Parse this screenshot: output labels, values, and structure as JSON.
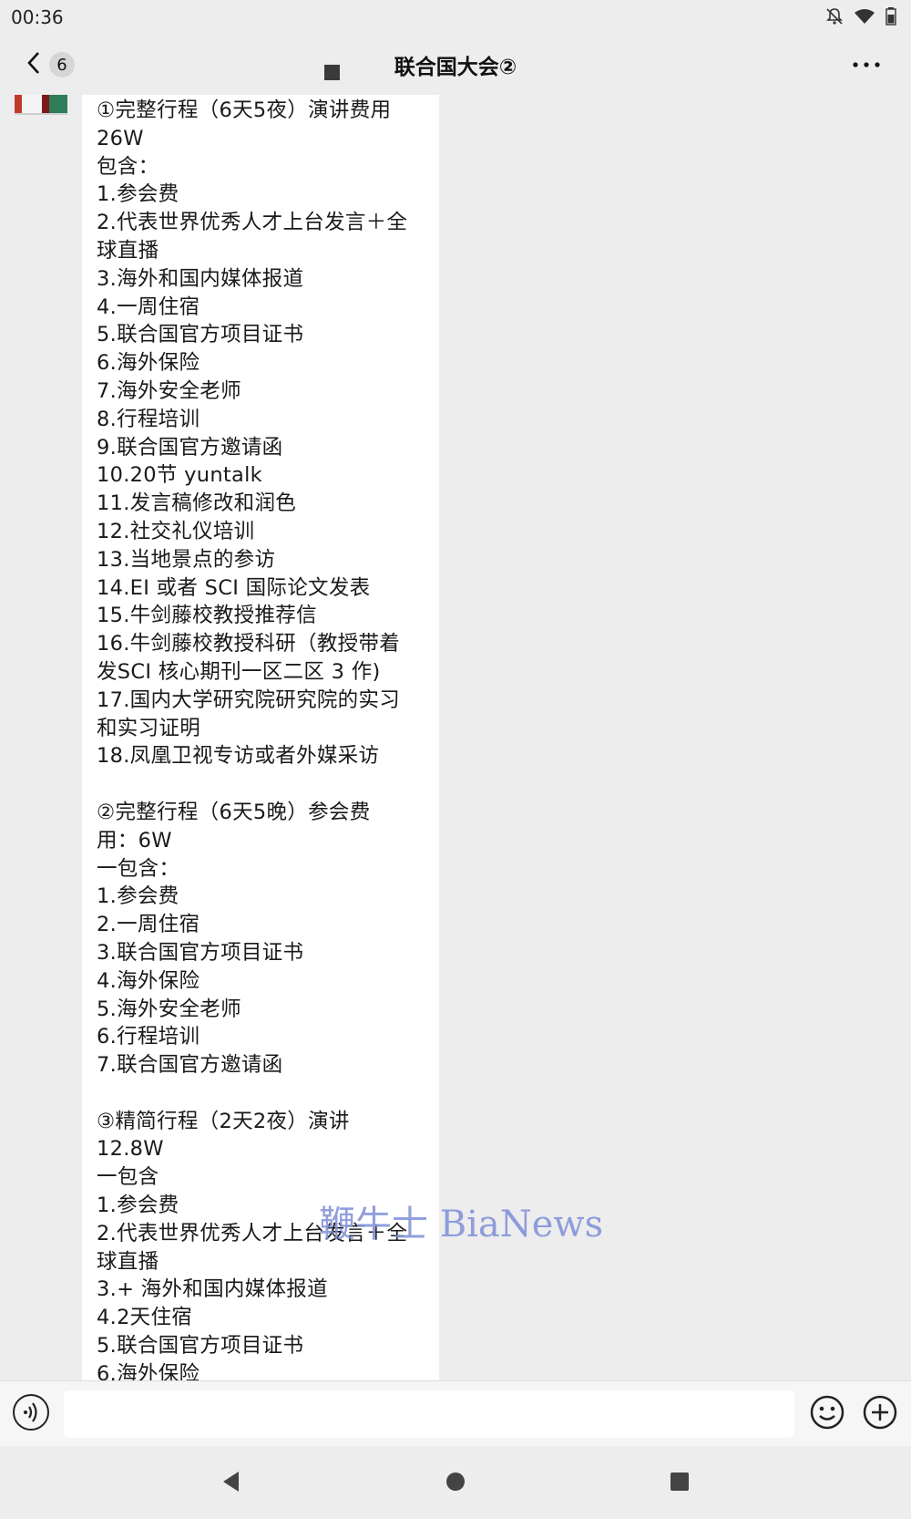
{
  "status_bar": {
    "time": "00:36"
  },
  "nav": {
    "unread_count": "6",
    "chat_title": "联合国大会②"
  },
  "message": {
    "text": "①完整行程（6天5夜）演讲费用\n26W\n包含：\n1.参会费\n2.代表世界优秀人才上台发言＋全\n球直播\n3.海外和国内媒体报道\n4.一周住宿\n5.联合国官方项目证书\n6.海外保险\n7.海外安全老师\n8.行程培训\n9.联合国官方邀请函\n10.20节 yuntalk\n11.发言稿修改和润色\n12.社交礼仪培训\n13.当地景点的参访\n14.EI 或者 SCI 国际论文发表\n15.牛剑藤校教授推荐信\n16.牛剑藤校教授科研（教授带着\n发SCI 核心期刊一区二区 3 作)\n17.国内大学研究院研究院的实习\n和实习证明\n18.凤凰卫视专访或者外媒采访\n\n②完整行程（6天5晚）参会费\n用：6W\n一包含：\n1.参会费\n2.一周住宿\n3.联合国官方项目证书\n4.海外保险\n5.海外安全老师\n6.行程培训\n7.联合国官方邀请函\n\n③精简行程（2天2夜）演讲\n12.8W\n一包含\n1.参会费\n2.代表世界优秀人才上台发言＋全\n球直播\n3.+ 海外和国内媒体报道\n4.2天住宿\n5.联合国官方项目证书\n6.海外保险"
  },
  "watermark": "鞭牛士 BiaNews",
  "input": {
    "value": ""
  },
  "colors": {
    "background": "#ededed",
    "bubble": "#ffffff",
    "watermark": "#7e8fd8"
  },
  "icons": {
    "back": "chevron-left-icon",
    "more": "more-dots-icon",
    "voice": "voice-icon",
    "emoji": "emoji-icon",
    "plus": "plus-icon",
    "nav_back": "triangle-back-icon",
    "nav_home": "circle-home-icon",
    "nav_recent": "square-recents-icon"
  }
}
